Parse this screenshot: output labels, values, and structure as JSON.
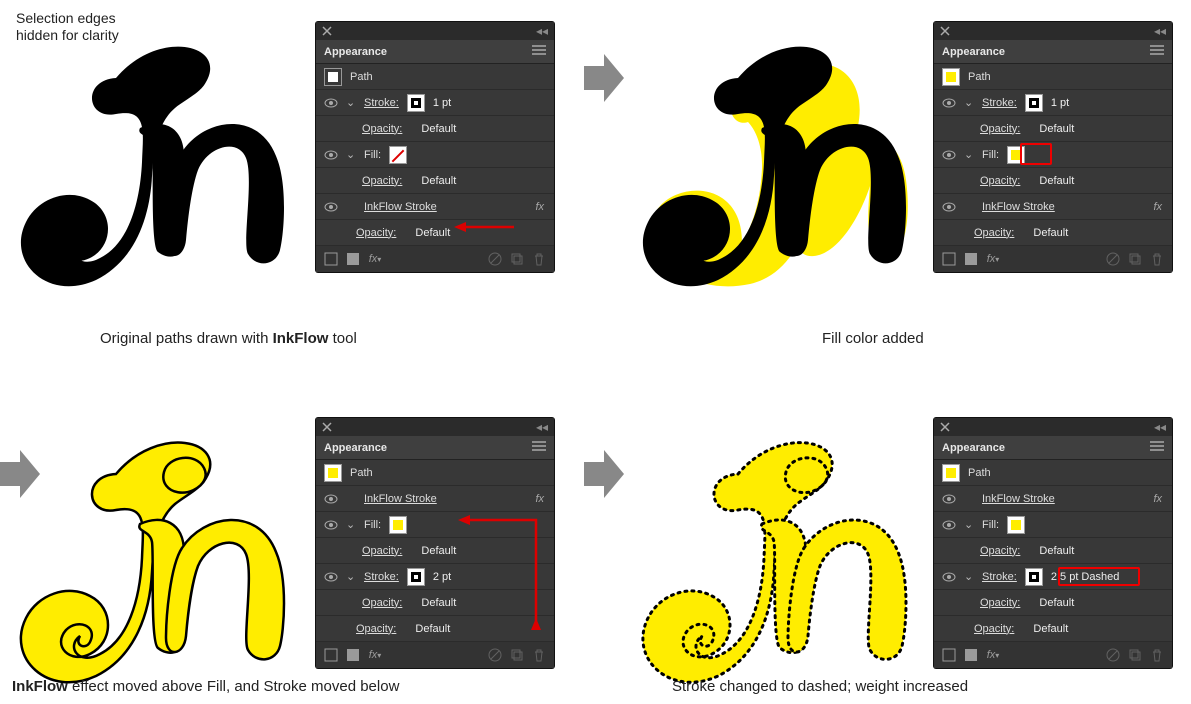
{
  "note": "Selection edges\nhidden for clarity",
  "captions": {
    "p1a": "Original paths drawn with ",
    "p1b": "InkFlow",
    "p1c": " tool",
    "p2": "Fill color added",
    "p3a": "InkFlow",
    "p3b": " effect moved above Fill, and Stroke moved below",
    "p4": "Stroke changed to dashed; weight increased"
  },
  "panel_title": "Appearance",
  "object_type": "Path",
  "labels": {
    "stroke": "Stroke:",
    "fill": "Fill:",
    "opacity": "Opacity:",
    "default": "Default",
    "inkflow": "InkFlow Stroke",
    "fx": "fx"
  },
  "stroke_values": {
    "p1": "1 pt",
    "p2": "1 pt",
    "p3": "2 pt",
    "p4": "2.5 pt Dashed"
  },
  "colors": {
    "yellow": "#ffed00",
    "black": "#000000"
  }
}
